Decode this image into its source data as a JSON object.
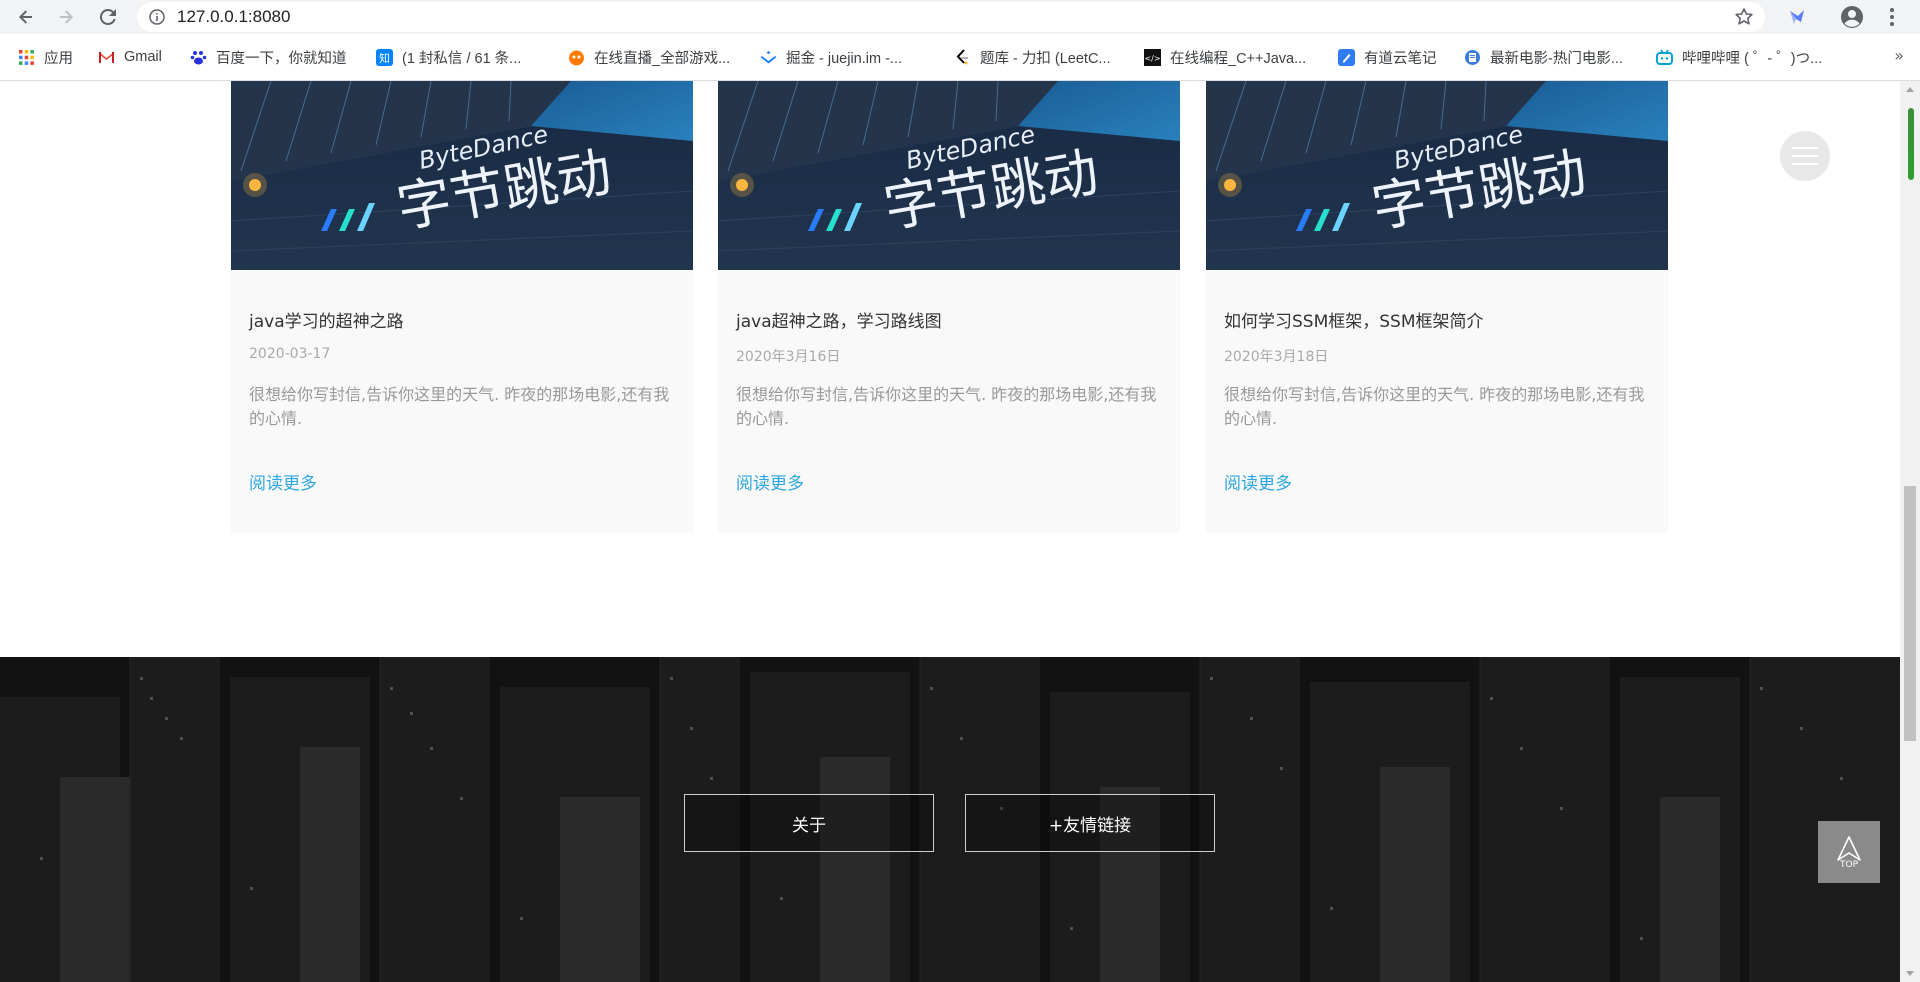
{
  "browser": {
    "url": "127.0.0.1:8080"
  },
  "bookmarks": [
    {
      "label": "应用",
      "icon": "apps-grid-icon"
    },
    {
      "label": "Gmail",
      "icon": "gmail-icon"
    },
    {
      "label": "百度一下，你就知道",
      "icon": "baidu-paw-icon"
    },
    {
      "label": "(1 封私信 / 61 条...",
      "icon": "zhihu-icon"
    },
    {
      "label": "在线直播_全部游戏...",
      "icon": "douyu-icon"
    },
    {
      "label": "掘金 - juejin.im -...",
      "icon": "juejin-icon"
    },
    {
      "label": "题库 - 力扣 (LeetC...",
      "icon": "leetcode-icon"
    },
    {
      "label": "在线编程_C++Java...",
      "icon": "nowcoder-icon"
    },
    {
      "label": "有道云笔记",
      "icon": "youdao-note-icon"
    },
    {
      "label": "最新电影-热门电影...",
      "icon": "movie-site-icon"
    },
    {
      "label": "哔哩哔哩 ( ゜- ゜)つ...",
      "icon": "bilibili-icon"
    }
  ],
  "cards": [
    {
      "title": "java学习的超神之路",
      "date": "2020-03-17",
      "excerpt": "很想给你写封信,告诉你这里的天气. 昨夜的那场电影,还有我的心情.",
      "more": "阅读更多",
      "image_text_en": "ByteDance",
      "image_text_cn": "字节跳动"
    },
    {
      "title": "java超神之路，学习路线图",
      "date": "2020年3月16日",
      "excerpt": "很想给你写封信,告诉你这里的天气. 昨夜的那场电影,还有我的心情.",
      "more": "阅读更多",
      "image_text_en": "ByteDance",
      "image_text_cn": "字节跳动"
    },
    {
      "title": "如何学习SSM框架，SSM框架简介",
      "date": "2020年3月18日",
      "excerpt": "很想给你写封信,告诉你这里的天气. 昨夜的那场电影,还有我的心情.",
      "more": "阅读更多",
      "image_text_en": "ByteDance",
      "image_text_cn": "字节跳动"
    }
  ],
  "footer": {
    "about": "关于",
    "friend_links": "+友情链接",
    "to_top": "TOP"
  }
}
